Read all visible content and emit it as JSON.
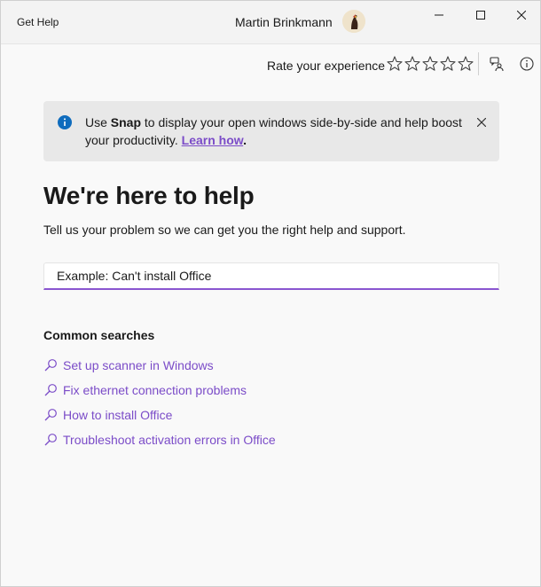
{
  "titlebar": {
    "app_title": "Get Help",
    "user_name": "Martin Brinkmann"
  },
  "toolbar": {
    "rate_label": "Rate your experience",
    "star_count": 5,
    "rating": 0
  },
  "banner": {
    "prefix": "Use ",
    "bold_word": "Snap",
    "message": " to display your open windows side-by-side and help boost your productivity.  ",
    "link_label": "Learn how",
    "suffix": "."
  },
  "main": {
    "heading": "We're here to help",
    "subtext": "Tell us your problem so we can get you the right help and support.",
    "search_placeholder": "Example: Can't install Office"
  },
  "common": {
    "title": "Common searches",
    "items": [
      {
        "label": "Set up scanner in Windows"
      },
      {
        "label": "Fix ethernet connection problems"
      },
      {
        "label": "How to install Office"
      },
      {
        "label": "Troubleshoot activation errors in Office"
      }
    ]
  },
  "colors": {
    "accent": "#7b4cc8",
    "info_blue": "#0f6cbd",
    "banner_bg": "#e8e8e8"
  }
}
